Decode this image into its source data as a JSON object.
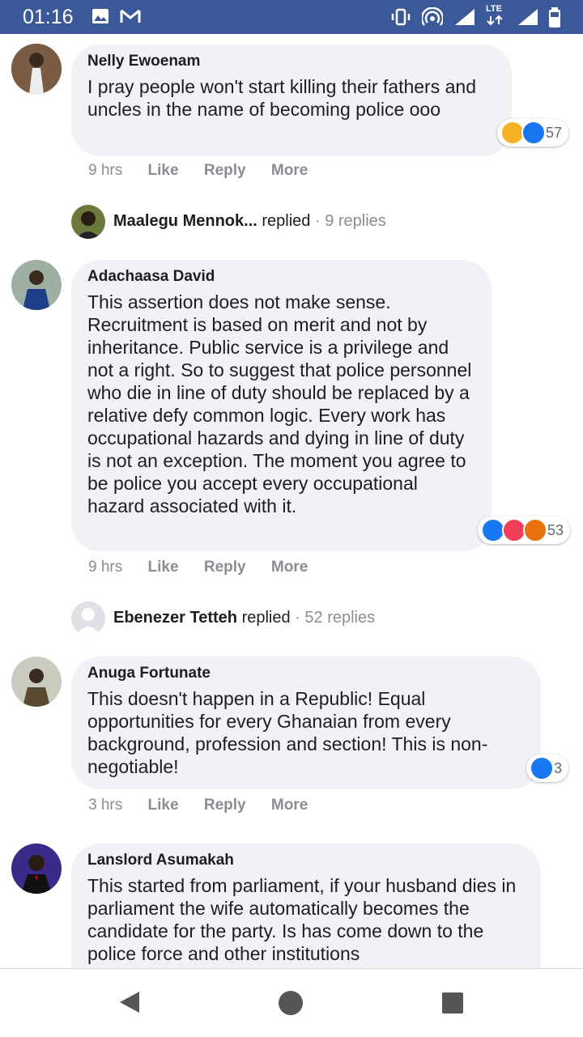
{
  "status_bar": {
    "time": "01:16",
    "network": "LTE"
  },
  "comments": [
    {
      "author": "Nelly Ewoenam",
      "text": "I pray people won't start killing their fathers and uncles in the name of becoming police ooo",
      "time": "9 hrs",
      "reaction_count": "57"
    },
    {
      "author": "Adachaasa David",
      "text": "This assertion does not make sense. Recruitment is based on merit and not by inheritance. Public service is a privilege and not a right. So to suggest that police personnel who die in line of duty should be replaced by a relative defy common logic. Every work has occupational hazards and dying in line of duty is not an exception. The moment you agree to be police you accept every occupational hazard associated with it.",
      "time": "9 hrs",
      "reaction_count": "53"
    },
    {
      "author": "Anuga Fortunate",
      "text": "This doesn't happen in a Republic! Equal opportunities for every Ghanaian from every background, profession and section! This is non-negotiable!",
      "time": "3 hrs",
      "reaction_count": "3"
    },
    {
      "author": "Lanslord Asumakah",
      "text": "This started from parliament, if your husband dies in parliament the wife automatically becomes the candidate for the party. Is has come down to the police force and other institutions",
      "time": "",
      "reaction_count": ""
    }
  ],
  "actions": {
    "like": "Like",
    "reply": "Reply",
    "more": "More"
  },
  "replies": [
    {
      "name": "Maalegu Mennok...",
      "verb": "replied",
      "count": "· 9 replies"
    },
    {
      "name": "Ebenezer Tetteh",
      "verb": "replied",
      "count": "· 52 replies"
    }
  ],
  "colors": {
    "status_bar": "#3b5998",
    "bubble": "#f0f2f5",
    "like_blue": "#1877f2",
    "muted": "#8a8d91"
  }
}
